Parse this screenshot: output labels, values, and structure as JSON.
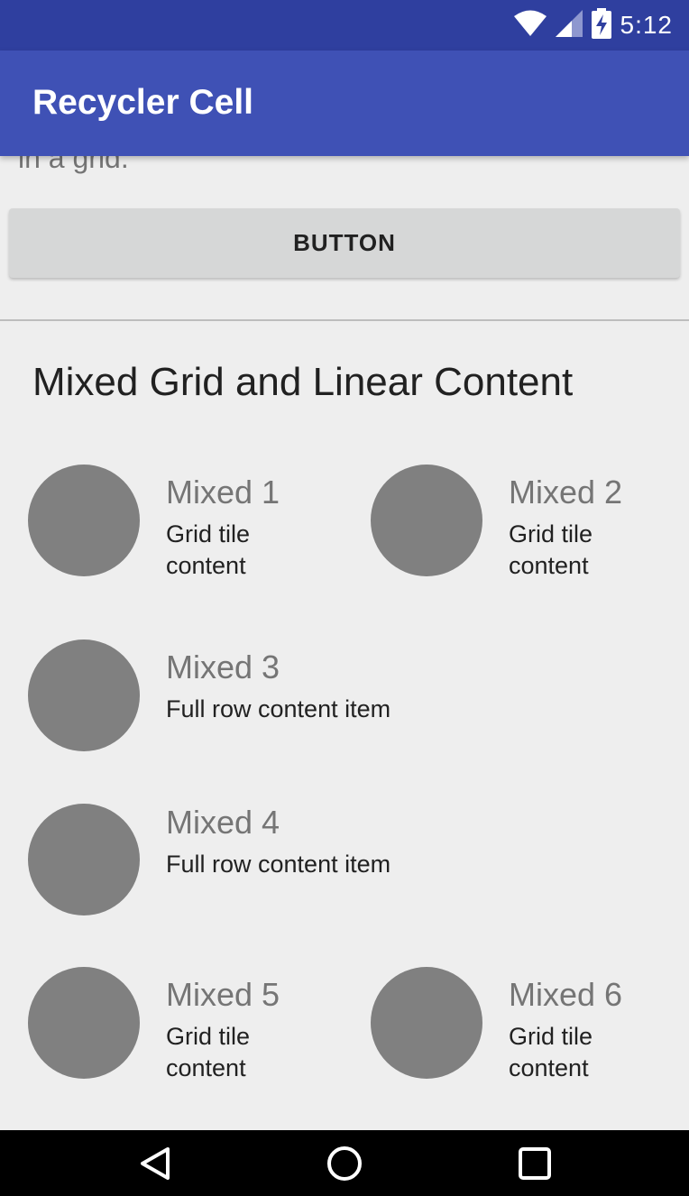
{
  "status_bar": {
    "time": "5:12",
    "icons": [
      "wifi-icon",
      "cell-signal-icon",
      "battery-charging-icon"
    ]
  },
  "app_bar": {
    "title": "Recycler Cell"
  },
  "content": {
    "partial_text": "in a grid.",
    "button_label": "BUTTON",
    "section_title": "Mixed Grid and Linear Content",
    "items": [
      {
        "title": "Mixed 1",
        "body": "Grid tile content",
        "layout": "grid"
      },
      {
        "title": "Mixed 2",
        "body": "Grid tile content",
        "layout": "grid"
      },
      {
        "title": "Mixed 3",
        "body": "Full row content item",
        "layout": "row"
      },
      {
        "title": "Mixed 4",
        "body": "Full row content item",
        "layout": "row"
      },
      {
        "title": "Mixed 5",
        "body": "Grid tile content",
        "layout": "grid"
      },
      {
        "title": "Mixed 6",
        "body": "Grid tile content",
        "layout": "grid"
      }
    ]
  },
  "colors": {
    "status_bar": "#2f3f9f",
    "app_bar": "#3f51b5",
    "background": "#eeeeee",
    "avatar": "#808080"
  },
  "nav_bar": {
    "icons": [
      "back-icon",
      "home-icon",
      "recents-icon"
    ]
  }
}
